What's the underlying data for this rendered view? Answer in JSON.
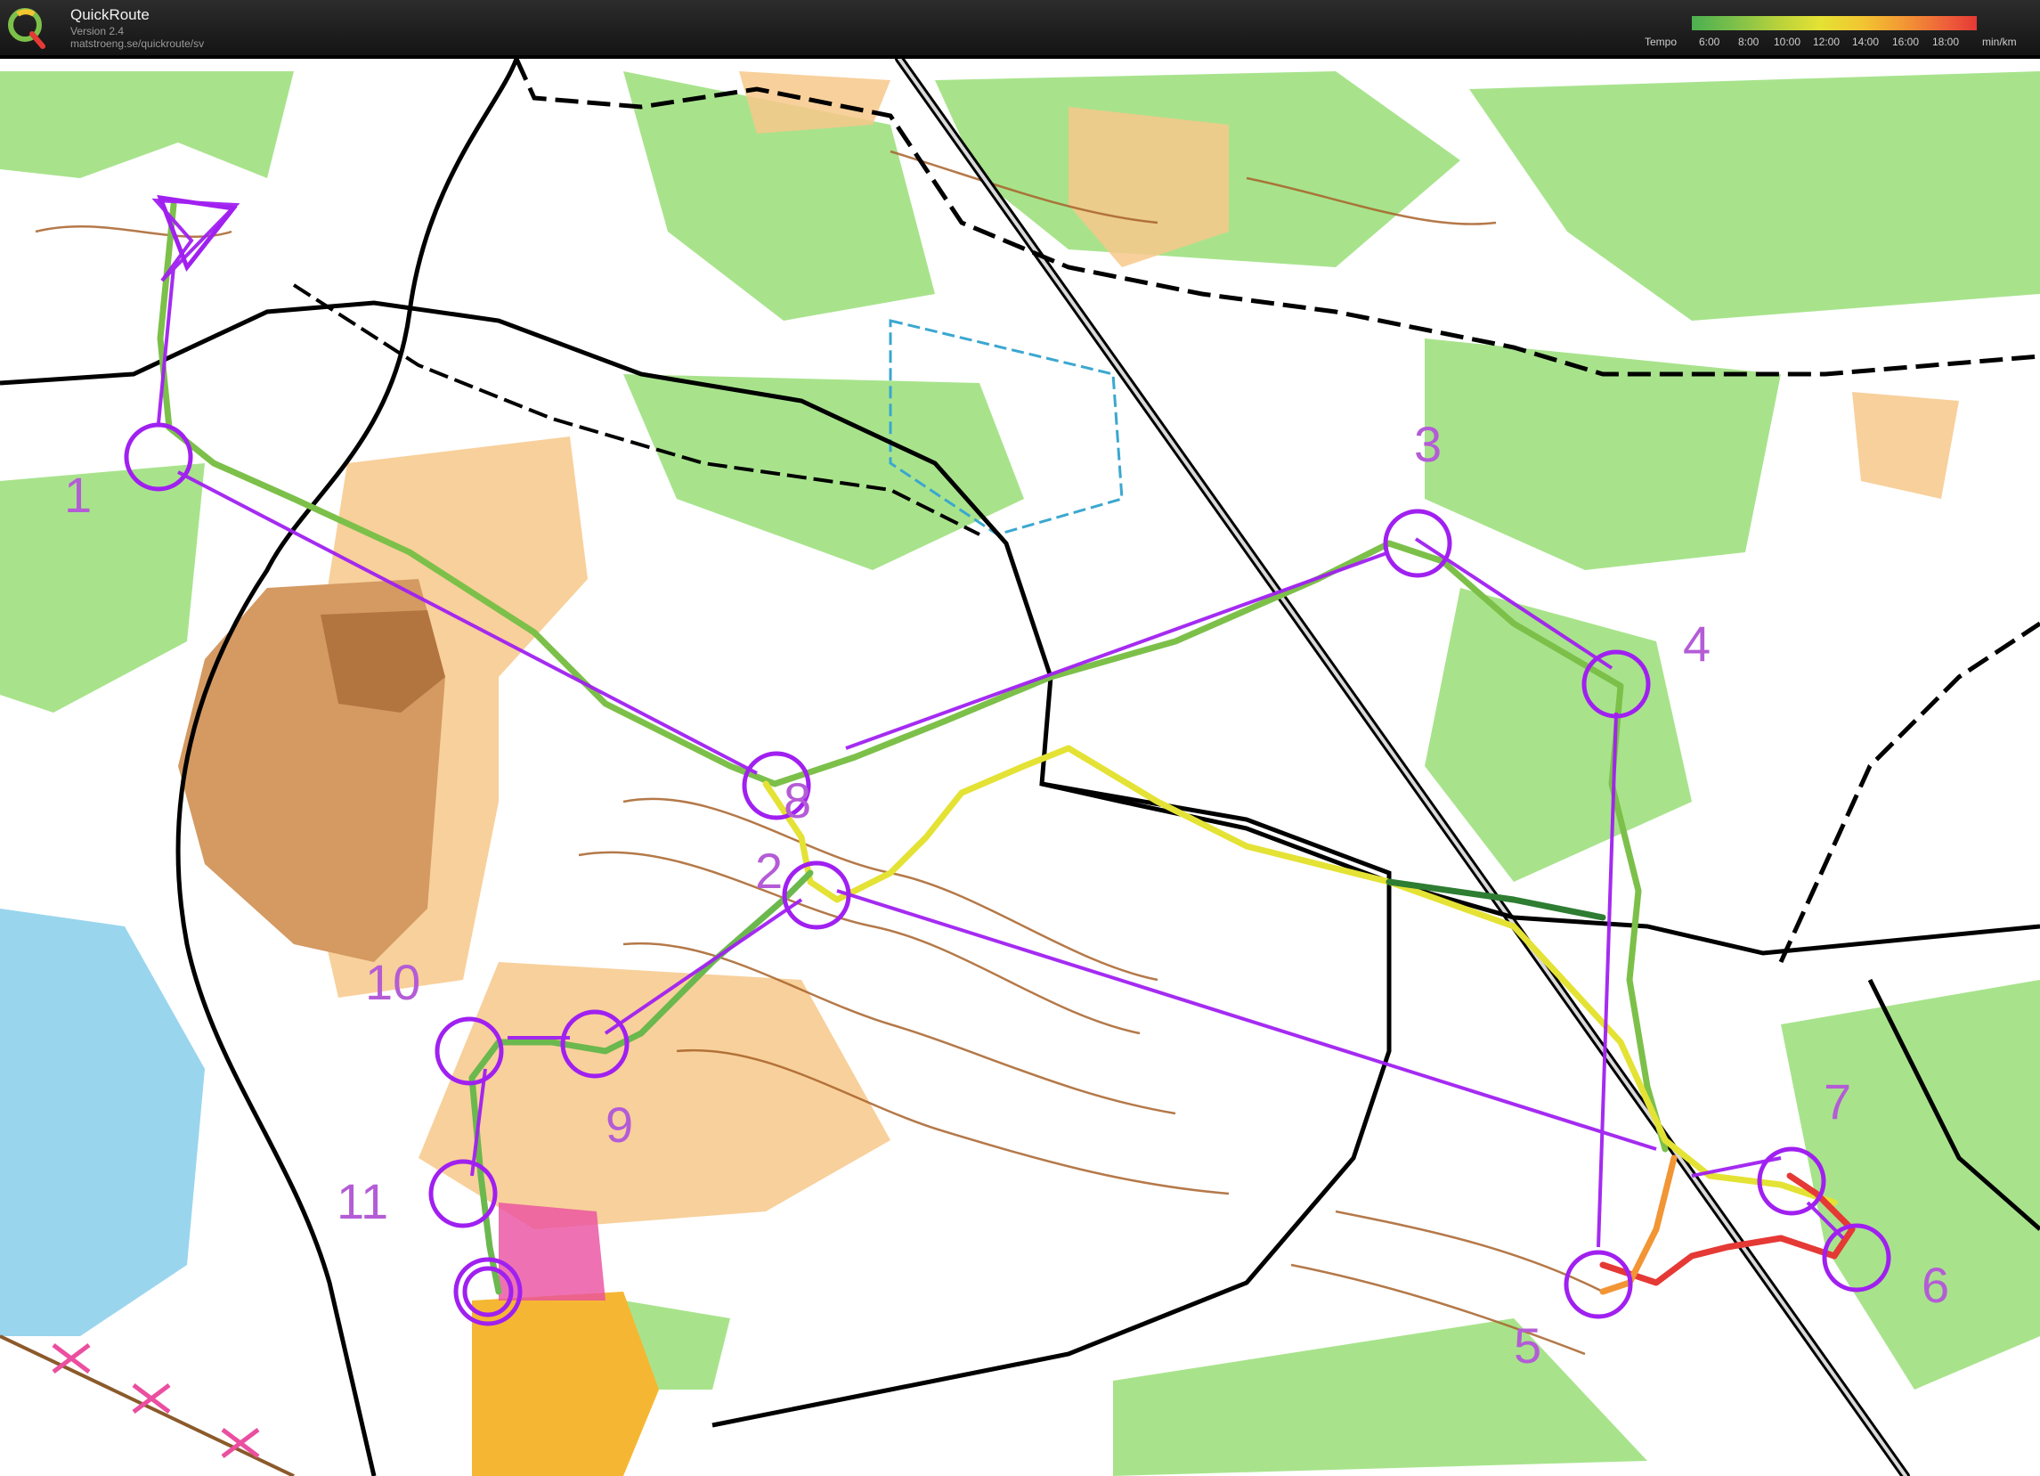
{
  "app": {
    "name": "QuickRoute",
    "version": "Version 2.4",
    "url": "matstroeng.se/quickroute/sv"
  },
  "legend": {
    "label": "Tempo",
    "ticks": [
      "6:00",
      "8:00",
      "10:00",
      "12:00",
      "14:00",
      "16:00",
      "18:00"
    ],
    "unit": "min/km"
  },
  "course": {
    "color": "#a020f0",
    "controls": [
      "1",
      "2",
      "3",
      "4",
      "5",
      "6",
      "7",
      "8",
      "9",
      "10",
      "11"
    ]
  },
  "colors": {
    "forest_green": "#8fdc6e",
    "rough_open": "#f7c88a",
    "open_land": "#e8a060",
    "marsh_blue": "#3aa7d0",
    "track": "#000000",
    "contour": "#a8622a"
  }
}
